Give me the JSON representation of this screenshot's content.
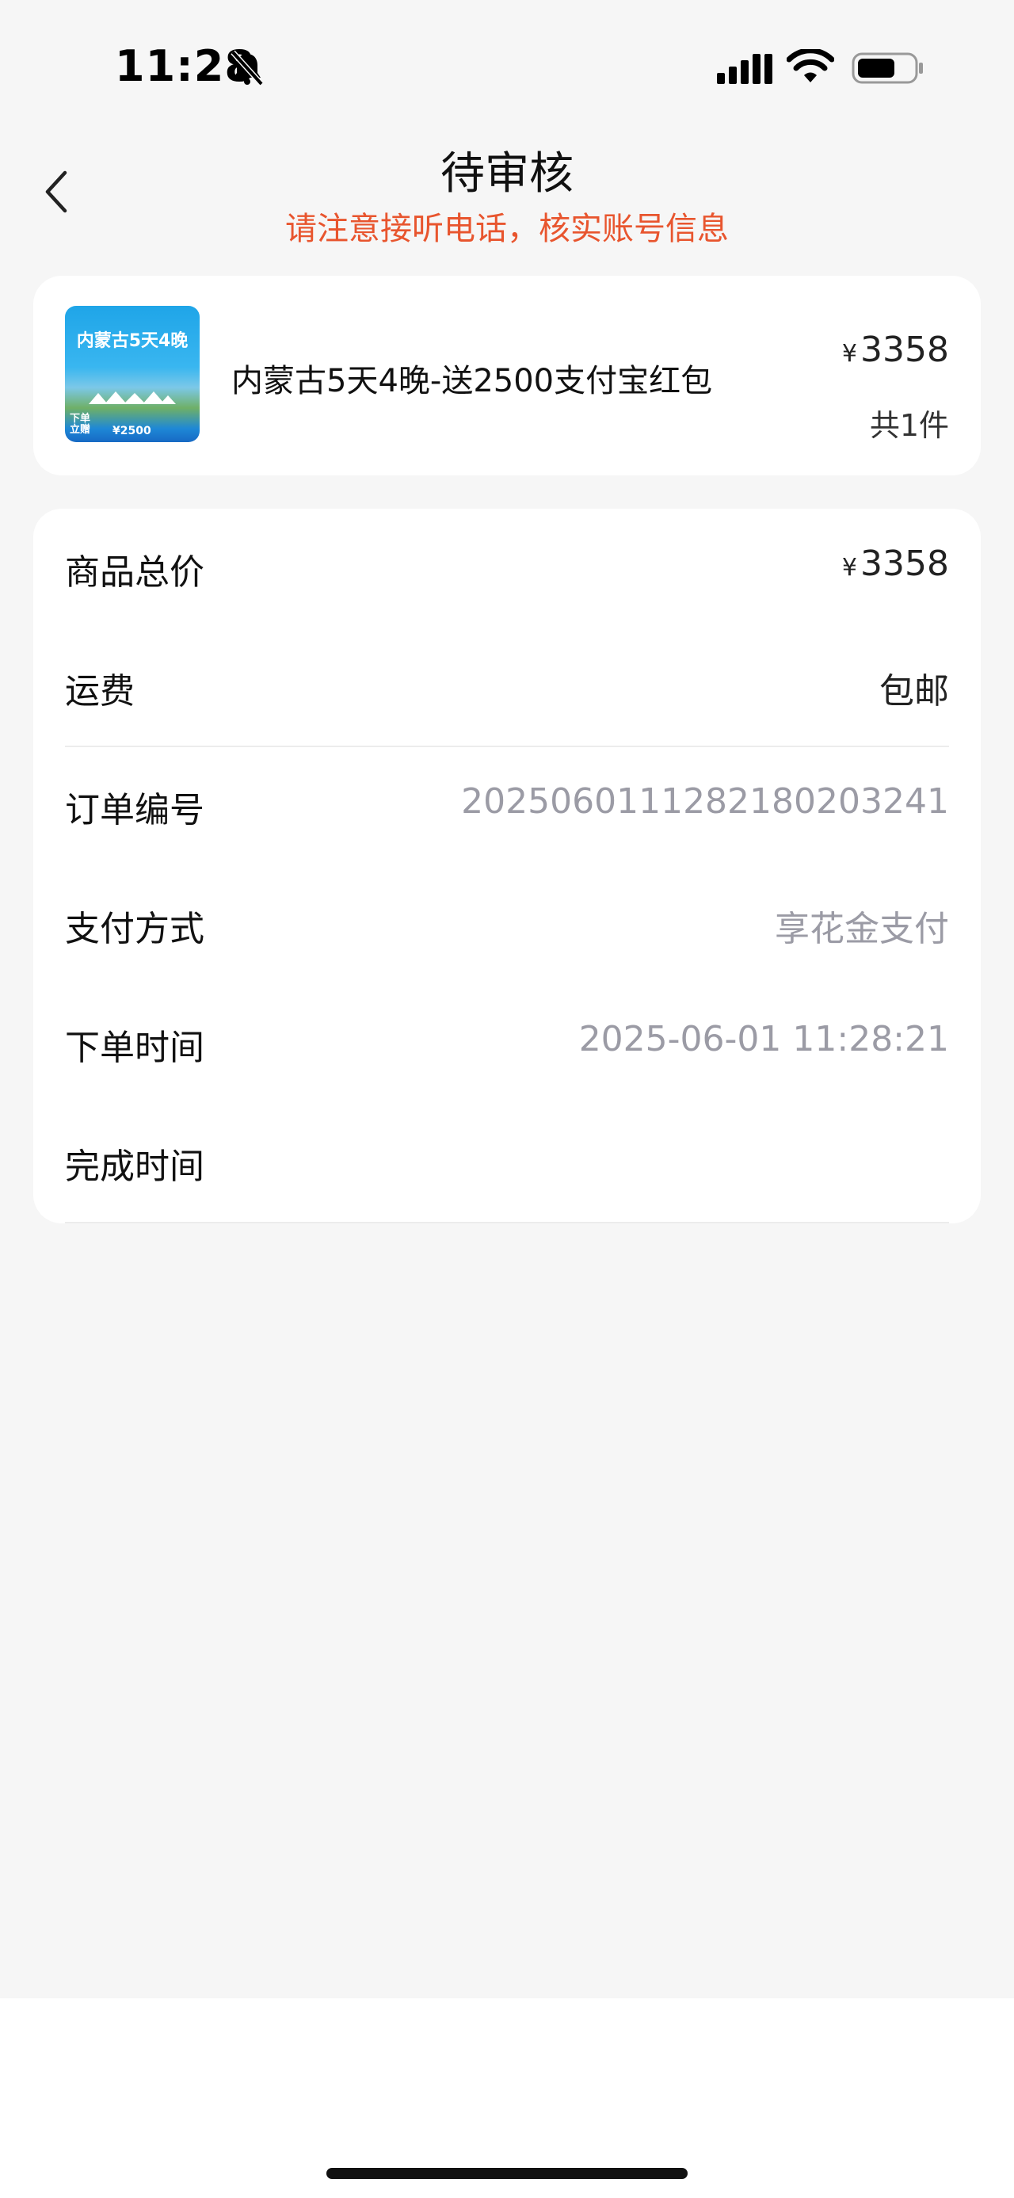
{
  "status_bar": {
    "time": "11:28"
  },
  "header": {
    "title": "待审核",
    "subtitle": "请注意接听电话，核实账号信息"
  },
  "product": {
    "thumbnail_title": "内蒙古5天4晚",
    "thumbnail_badge": "下单\n立赠",
    "thumbnail_price": "¥2500",
    "name": "内蒙古5天4晚-送2500支付宝红包",
    "price_symbol": "¥",
    "price": "3358",
    "quantity": "共1件"
  },
  "details": {
    "total_label": "商品总价",
    "total_symbol": "¥",
    "total_value": "3358",
    "shipping_label": "运费",
    "shipping_value": "包邮",
    "order_no_label": "订单编号",
    "order_no_value": "20250601112821802032​41",
    "payment_label": "支付方式",
    "payment_value": "享花金支付",
    "order_time_label": "下单时间",
    "order_time_value": "2025-06-01 11:28:21",
    "complete_time_label": "完成时间",
    "complete_time_value": ""
  },
  "colors": {
    "accent": "#e8552e",
    "muted_text": "#9b9ba5",
    "background": "#f6f6f6",
    "card": "#ffffff"
  }
}
